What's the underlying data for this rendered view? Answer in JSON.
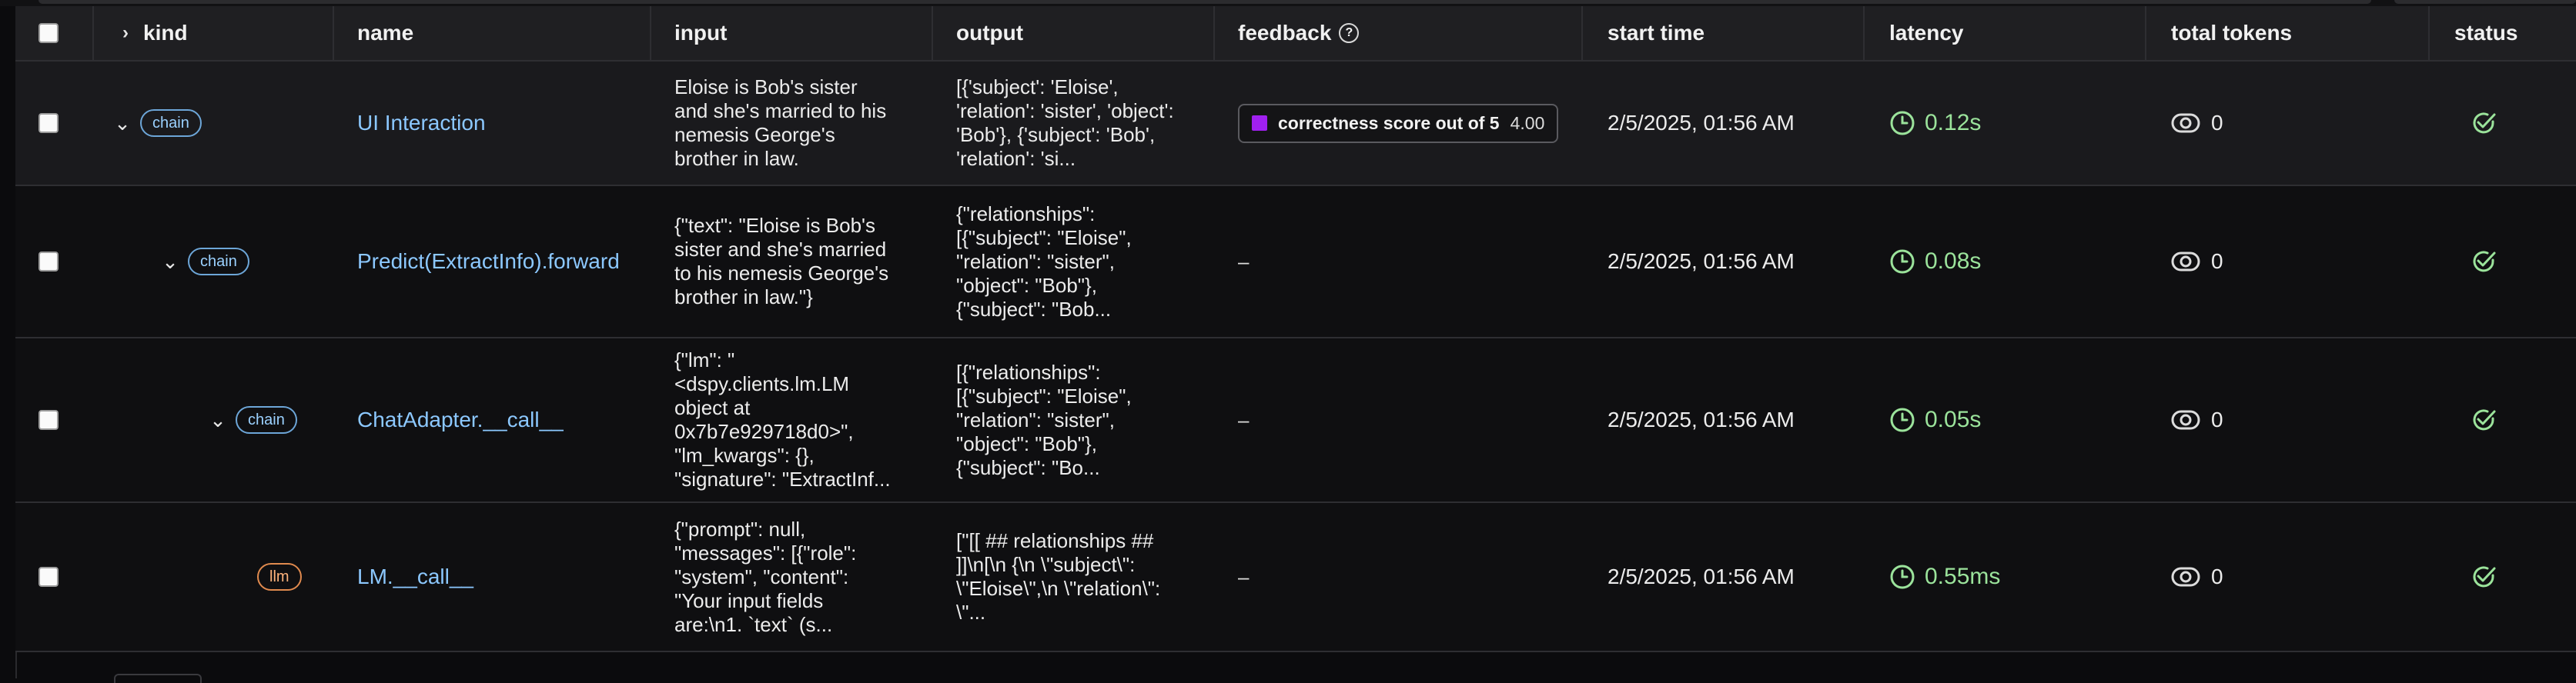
{
  "header": {
    "kind": "kind",
    "name": "name",
    "input": "input",
    "output": "output",
    "feedback": "feedback",
    "start_time": "start time",
    "latency": "latency",
    "total_tokens": "total tokens",
    "status": "status"
  },
  "rows": [
    {
      "kind": "chain",
      "name": "UI Interaction",
      "input": "Eloise is Bob's sister\nand she's married to his\nnemesis George's\nbrother in law.",
      "output": "[{'subject': 'Eloise',\n'relation': 'sister', 'object':\n'Bob'}, {'subject': 'Bob',\n'relation': 'si...",
      "feedback_label": "correctness score out of 5",
      "feedback_value": "4.00",
      "start_time": "2/5/2025, 01:56 AM",
      "latency": "0.12s",
      "tokens": "0"
    },
    {
      "kind": "chain",
      "name": "Predict(ExtractInfo).forward",
      "input": "{\"text\": \"Eloise is Bob's\nsister and she's married\nto his nemesis George's\nbrother in law.\"}",
      "output": "{\"relationships\":\n[{\"subject\": \"Eloise\",\n\"relation\": \"sister\",\n\"object\": \"Bob\"},\n{\"subject\": \"Bob...",
      "feedback": "–",
      "start_time": "2/5/2025, 01:56 AM",
      "latency": "0.08s",
      "tokens": "0"
    },
    {
      "kind": "chain",
      "name": "ChatAdapter.__call__",
      "input": "{\"lm\": \"\n<dspy.clients.lm.LM\nobject at\n0x7b7e929718d0>\",\n\"lm_kwargs\": {},\n\"signature\": \"ExtractInf...",
      "output": "[{\"relationships\":\n[{\"subject\": \"Eloise\",\n\"relation\": \"sister\",\n\"object\": \"Bob\"},\n{\"subject\": \"Bo...",
      "feedback": "–",
      "start_time": "2/5/2025, 01:56 AM",
      "latency": "0.05s",
      "tokens": "0"
    },
    {
      "kind": "llm",
      "name": "LM.__call__",
      "input": "{\"prompt\": null,\n\"messages\": [{\"role\":\n\"system\", \"content\":\n\"Your input fields\nare:\\n1. `text` (s...",
      "output": "[\"[[ ## relationships ##\n]]\\n[\\n {\\n \\\"subject\\\":\n\\\"Eloise\\\",\\n \\\"relation\\\":\n\\\"...",
      "feedback": "–",
      "start_time": "2/5/2025, 01:56 AM",
      "latency": "0.55ms",
      "tokens": "0"
    }
  ],
  "colors": {
    "accent_name": "#8cc8ff",
    "latency_green": "#9be39b",
    "chain_badge": "#6da6d8",
    "llm_badge": "#e08a4e",
    "feedback_swatch": "#a020f0"
  },
  "icons": {
    "latency": "clock-icon",
    "tokens": "token-icon",
    "status": "check-circle-icon",
    "help": "help-icon"
  }
}
